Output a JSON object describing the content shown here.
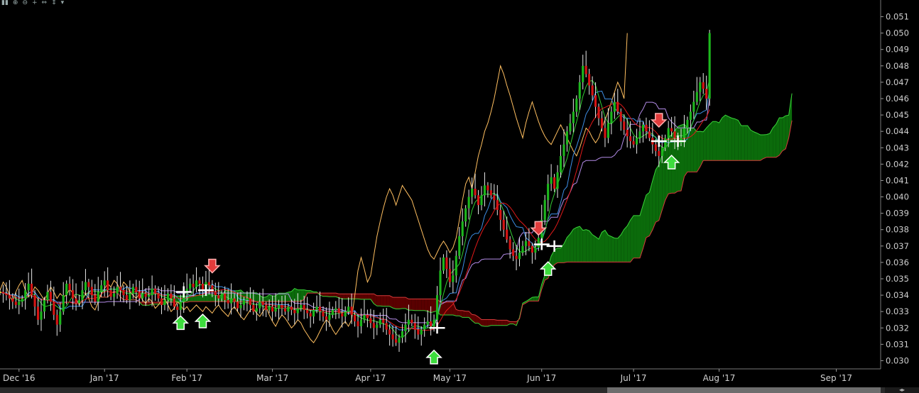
{
  "toolbar": {
    "icons": [
      "bars-icon",
      "zoom-in-icon",
      "zoom-out-icon",
      "crosshair-icon",
      "pan-icon",
      "fit-icon",
      "dropdown-icon"
    ]
  },
  "colors": {
    "background": "#000000",
    "bull_candle": "#1db81d",
    "bear_candle": "#d71414",
    "doji": "#ffff00",
    "tenkan": "#3d8fe6",
    "kijun": "#e01919",
    "chikou": "#ffbf60",
    "senkou_a": "#39d339",
    "senkou_b": "#d63a3a",
    "cloud_bull": "#0b6b0b",
    "cloud_bear": "#5a0000",
    "ma_purple": "#b48ce8",
    "ma_green": "#33cc33",
    "axis_text": "#d0d0d0",
    "grid": "#1e1e1e"
  },
  "chart_data": {
    "type": "ichimoku-candlestick",
    "ylim": [
      0.0295,
      0.0515
    ],
    "y_ticks": [
      "0.030",
      "0.031",
      "0.032",
      "0.033",
      "0.034",
      "0.035",
      "0.036",
      "0.037",
      "0.038",
      "0.039",
      "0.040",
      "0.041",
      "0.042",
      "0.043",
      "0.044",
      "0.045",
      "0.046",
      "0.047",
      "0.048",
      "0.049",
      "0.050",
      "0.051"
    ],
    "x_ticks": [
      "Dec '16",
      "Jan '17",
      "Feb '17",
      "Mar '17",
      "Apr '17",
      "May '17",
      "Jun '17",
      "Jul '17",
      "Aug '17",
      "Sep '17"
    ],
    "x_tick_index": [
      6,
      33,
      59,
      86,
      117,
      142,
      171,
      200,
      227,
      264
    ],
    "x_range": [
      0,
      278
    ],
    "close": [
      0.0342,
      0.0341,
      0.034,
      0.0338,
      0.0336,
      0.0334,
      0.0336,
      0.0338,
      0.0343,
      0.0347,
      0.034,
      0.0333,
      0.0325,
      0.033,
      0.0337,
      0.0342,
      0.0336,
      0.0328,
      0.0322,
      0.033,
      0.034,
      0.0347,
      0.0343,
      0.0338,
      0.0335,
      0.0337,
      0.0343,
      0.0348,
      0.0345,
      0.034,
      0.0336,
      0.0342,
      0.0346,
      0.0349,
      0.0343,
      0.0339,
      0.0341,
      0.0345,
      0.0343,
      0.034,
      0.0337,
      0.0341,
      0.0345,
      0.0342,
      0.0338,
      0.0341,
      0.0339,
      0.034,
      0.0344,
      0.0341,
      0.0338,
      0.0334,
      0.0337,
      0.0341,
      0.0338,
      0.0333,
      0.0331,
      0.0336,
      0.0341,
      0.0344,
      0.0347,
      0.0345,
      0.0349,
      0.0347,
      0.0343,
      0.0348,
      0.0346,
      0.0342,
      0.034,
      0.0338,
      0.0341,
      0.0337,
      0.0335,
      0.0338,
      0.0336,
      0.0332,
      0.0334,
      0.0337,
      0.0338,
      0.0334,
      0.033,
      0.0332,
      0.0336,
      0.0334,
      0.0331,
      0.0333,
      0.033,
      0.0332,
      0.0334,
      0.0332,
      0.033,
      0.0333,
      0.0331,
      0.0329,
      0.0332,
      0.0334,
      0.0331,
      0.0329,
      0.0327,
      0.0331,
      0.0333,
      0.033,
      0.0327,
      0.0325,
      0.0328,
      0.0331,
      0.0332,
      0.0329,
      0.0327,
      0.033,
      0.0333,
      0.0328,
      0.0324,
      0.0321,
      0.0325,
      0.0328,
      0.0326,
      0.0323,
      0.032,
      0.0322,
      0.0325,
      0.0323,
      0.0319,
      0.0316,
      0.0313,
      0.0311,
      0.0314,
      0.0318,
      0.0322,
      0.0325,
      0.0323,
      0.0319,
      0.0316,
      0.0319,
      0.0322,
      0.0324,
      0.0321,
      0.0325,
      0.034,
      0.0355,
      0.0363,
      0.0356,
      0.0348,
      0.0352,
      0.0364,
      0.0376,
      0.0385,
      0.0393,
      0.04,
      0.0405,
      0.0401,
      0.0395,
      0.0401,
      0.0407,
      0.0404,
      0.0401,
      0.0398,
      0.0392,
      0.0386,
      0.038,
      0.0374,
      0.0368,
      0.0364,
      0.0362,
      0.0366,
      0.037,
      0.0373,
      0.037,
      0.0366,
      0.0369,
      0.0375,
      0.0386,
      0.0398,
      0.0408,
      0.0412,
      0.0405,
      0.0415,
      0.0425,
      0.0432,
      0.044,
      0.0445,
      0.0452,
      0.046,
      0.047,
      0.048,
      0.0475,
      0.0468,
      0.0462,
      0.0455,
      0.0448,
      0.0442,
      0.0436,
      0.0445,
      0.0452,
      0.0458,
      0.0452,
      0.0446,
      0.0441,
      0.0437,
      0.0434,
      0.0432,
      0.0436,
      0.044,
      0.0444,
      0.044,
      0.0436,
      0.0432,
      0.0428,
      0.0425,
      0.043,
      0.0436,
      0.0442,
      0.044,
      0.0436,
      0.0433,
      0.0436,
      0.0442,
      0.0447,
      0.0452,
      0.0458,
      0.0464,
      0.047,
      0.0466,
      0.046,
      0.05
    ],
    "bull_arrows": [
      [
        57,
        0.0323
      ],
      [
        64,
        0.0324
      ],
      [
        137,
        0.0302
      ],
      [
        173,
        0.0356
      ],
      [
        212,
        0.0421
      ]
    ],
    "bear_arrows": [
      [
        67,
        0.0358
      ],
      [
        170,
        0.0381
      ],
      [
        208,
        0.0447
      ]
    ],
    "crosses": [
      [
        58,
        0.0342
      ],
      [
        65,
        0.0343
      ],
      [
        138,
        0.032
      ],
      [
        171,
        0.0371
      ],
      [
        175,
        0.037
      ],
      [
        208,
        0.0434
      ],
      [
        214,
        0.0434
      ]
    ]
  }
}
